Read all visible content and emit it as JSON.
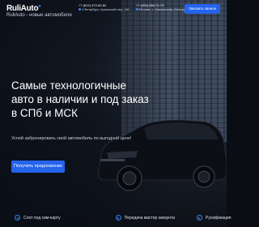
{
  "header": {
    "logo_name": "RuliAuto",
    "logo_tag": "RuliAuto - новые автомобили",
    "contact_spb": {
      "phone": "+7 (812) 372-62-82",
      "address": "г.Петербург, Уральский пер., 4А"
    },
    "contact_msk": {
      "phone": "+7 (495) 085-72-79",
      "address": "Москва, г. Химкинская, Молодёжная д.11"
    },
    "call_button": "Заказать звонок"
  },
  "hero": {
    "title": "Самые технологичные авто в наличии и под заказ в СПб и МСК",
    "subtitle": "Успей забронировать свой автомобиль по выгодной цене!",
    "cta": "Получить предложение"
  },
  "features": [
    {
      "icon": "sim-icon",
      "label": "Слот под сим-карту"
    },
    {
      "icon": "wizard-icon",
      "label": "Передача мастер аккаунта"
    },
    {
      "icon": "language-icon",
      "label": "Русификация"
    }
  ],
  "colors": {
    "accent": "#2563eb",
    "background": "#0a0d14"
  }
}
